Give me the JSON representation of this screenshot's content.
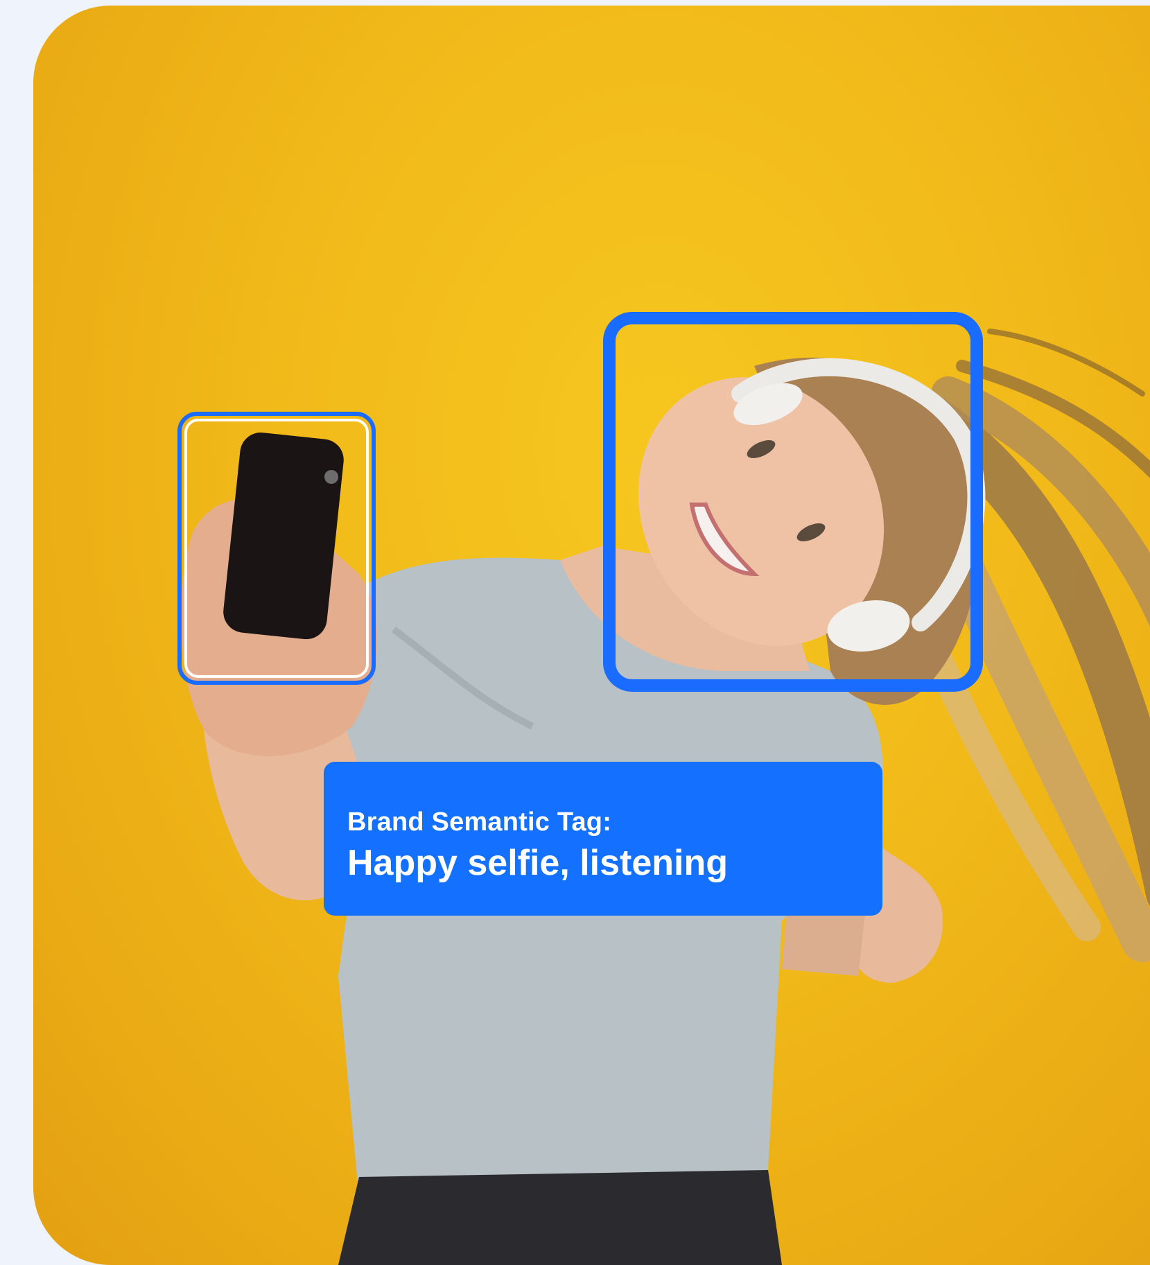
{
  "tag": {
    "label": "Brand Semantic Tag:",
    "value": "Happy selfie, listening"
  },
  "detections": [
    {
      "object": "smartphone"
    },
    {
      "object": "face with headphones"
    }
  ],
  "colors": {
    "accent": "#1470ff",
    "background": "#f3bf1b",
    "page": "#eef3fc"
  }
}
